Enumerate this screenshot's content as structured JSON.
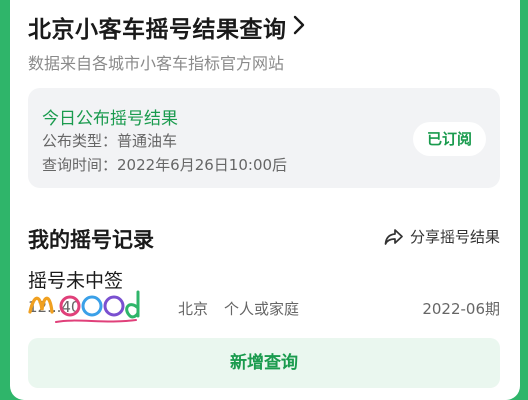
{
  "header": {
    "title": "北京小客车摇号结果查询",
    "subtitle": "数据来自各城市小客车指标官方网站"
  },
  "result": {
    "title": "今日公布摇号结果",
    "type_line": "公布类型：普通油车",
    "time_line": "查询时间：2022年6月26日10:00后",
    "subscribe_label": "已订阅"
  },
  "records": {
    "section_title": "我的摇号记录",
    "share_label": "分享摇号结果",
    "status": "摇号未中签",
    "code_visible": "12...40",
    "city": "北京",
    "type": "个人或家庭",
    "period": "2022-06期"
  },
  "actions": {
    "add_label": "新增查询"
  },
  "colors": {
    "background": "#2fb56a",
    "accent": "#1a9b4e",
    "result_box": "#f2f3f5",
    "add_button": "#eaf7ef"
  }
}
